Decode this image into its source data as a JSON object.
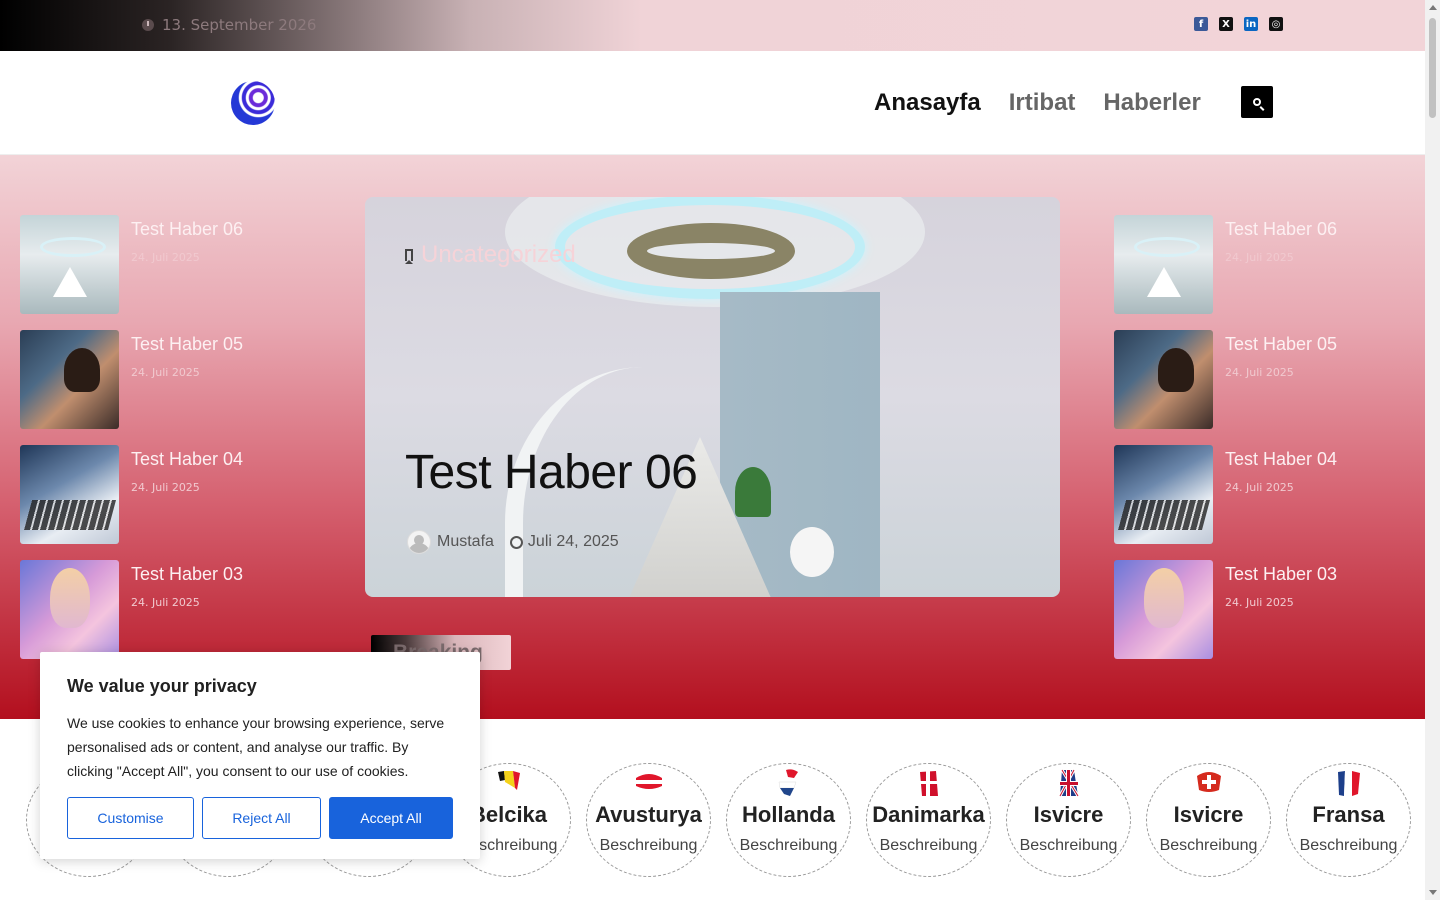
{
  "topbar": {
    "date": "13. September 2026",
    "social": [
      {
        "icon": "facebook-icon",
        "glyph": "f"
      },
      {
        "icon": "x-icon",
        "glyph": "X"
      },
      {
        "icon": "linkedin-icon",
        "glyph": "in"
      },
      {
        "icon": "instagram-icon",
        "glyph": "◎"
      }
    ]
  },
  "header": {
    "nav": [
      "Anasayfa",
      "Irtibat",
      "Haberler"
    ]
  },
  "sidebar_news": [
    {
      "title": "Test Haber 06",
      "date": "24. Juli 2025"
    },
    {
      "title": "Test Haber 05",
      "date": "24. Juli 2025"
    },
    {
      "title": "Test Haber 04",
      "date": "24. Juli 2025"
    },
    {
      "title": "Test Haber 03",
      "date": "24. Juli 2025"
    }
  ],
  "feature": {
    "category": "Uncategorized",
    "title": "Test Haber 06",
    "author": "Mustafa",
    "date": "Juli 24, 2025"
  },
  "breaking": {
    "label": "Breaking"
  },
  "countries": [
    {
      "name": "",
      "desc": "Beschreibung"
    },
    {
      "name": "",
      "desc": ""
    },
    {
      "name": "",
      "desc": ""
    },
    {
      "name": "Belcika",
      "desc": "Beschreibung"
    },
    {
      "name": "Avusturya",
      "desc": "Beschreibung"
    },
    {
      "name": "Hollanda",
      "desc": "Beschreibung"
    },
    {
      "name": "Danimarka",
      "desc": "Beschreibung"
    },
    {
      "name": "Isvicre",
      "desc": "Beschreibung"
    },
    {
      "name": "Isvicre",
      "desc": "Beschreibung"
    },
    {
      "name": "Fransa",
      "desc": "Beschreibung"
    }
  ],
  "cookie": {
    "title": "We value your privacy",
    "text": "We use cookies to enhance your browsing experience, serve personalised ads or content, and analyse our traffic. By clicking \"Accept All\", you consent to our use of cookies.",
    "customise": "Customise",
    "reject": "Reject All",
    "accept": "Accept All"
  },
  "colors": {
    "accent": "#1863dc",
    "hero_bottom": "#b30f1e"
  }
}
